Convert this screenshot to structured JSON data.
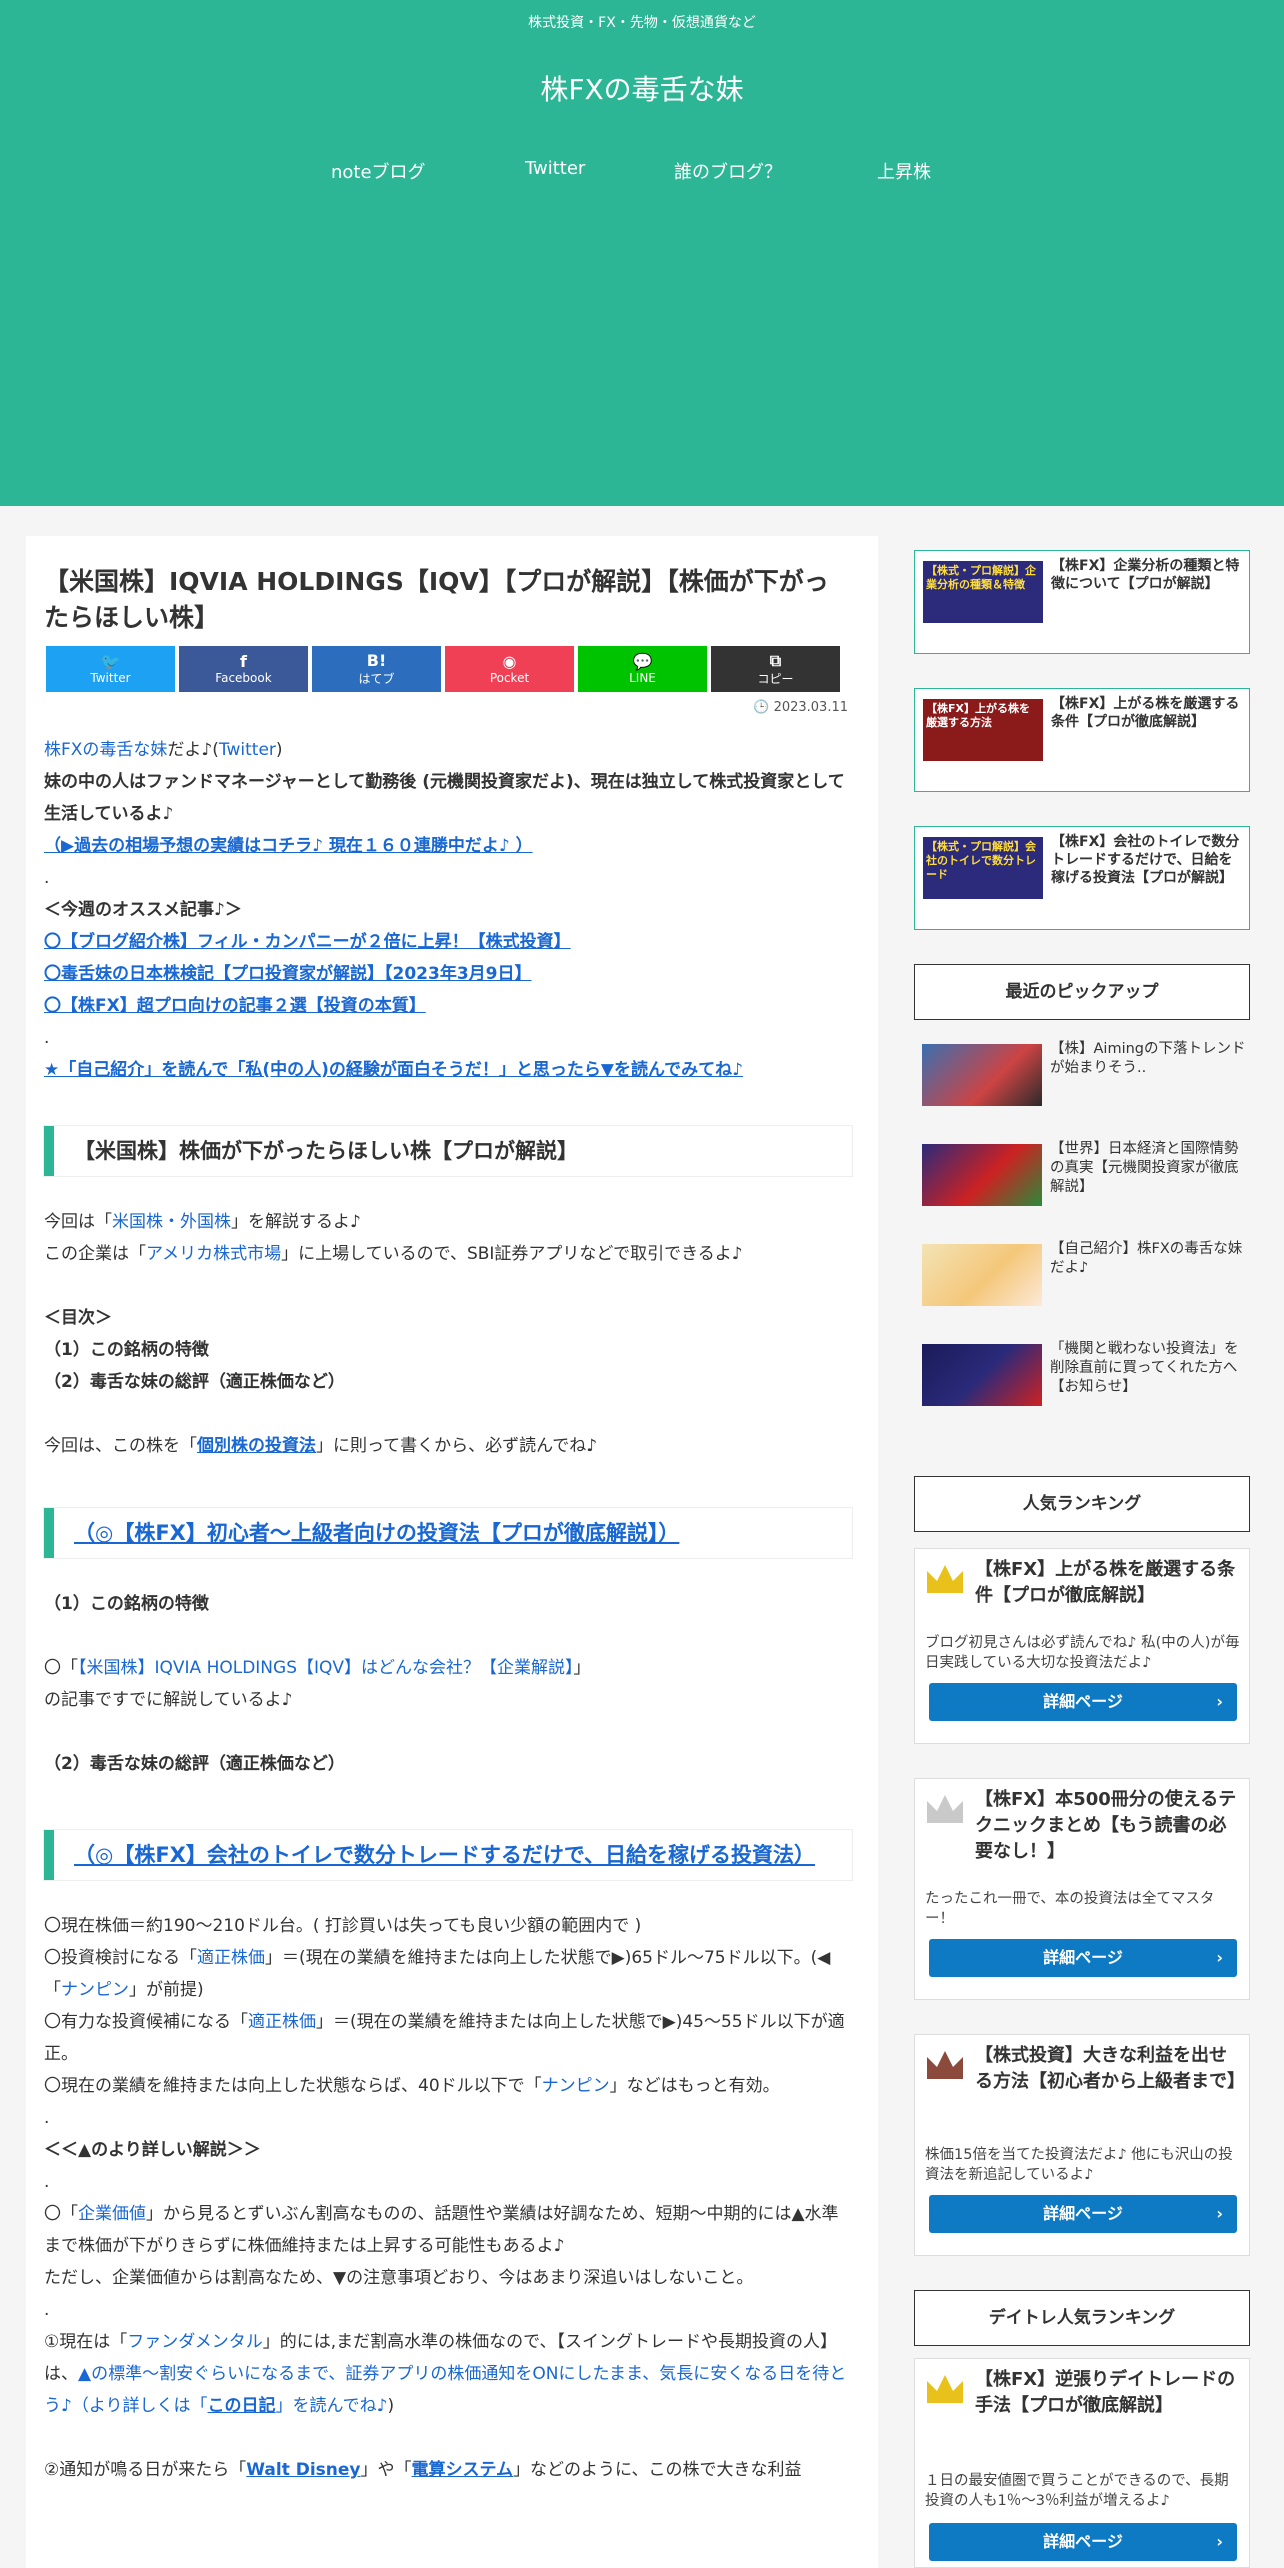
{
  "header": {
    "tagline": "株式投資・FX・先物・仮想通貨など",
    "title": "株FXの毒舌な妹",
    "nav": [
      "noteブログ",
      "Twitter",
      "誰のブログ？",
      "上昇株"
    ]
  },
  "post": {
    "title": "【米国株】IQVIA HOLDINGS【IQV】【プロが解説】【株価が下がったらほしい株】",
    "date": "2023.03.11",
    "share": [
      {
        "icon": "🐦",
        "label": "Twitter",
        "color": "#1da1f2"
      },
      {
        "icon": "f",
        "label": "Facebook",
        "color": "#3b5998"
      },
      {
        "icon": "B!",
        "label": "はてブ",
        "color": "#2c6ebd"
      },
      {
        "icon": "◉",
        "label": "Pocket",
        "color": "#ef4056"
      },
      {
        "icon": "💬",
        "label": "LINE",
        "color": "#00c300"
      },
      {
        "icon": "⧉",
        "label": "コピー",
        "color": "#333333"
      }
    ],
    "intro": {
      "link1": "株FXの毒舌な妹",
      "mid1": "だよ♪(",
      "link2": "Twitter",
      "end1": ")",
      "line2": "妹の中の人はファンドマネージャーとして勤務後 (元機関投資家だよ)、現在は独立して株式投資家として生活しているよ♪",
      "line3": "（▶過去の相場予想の実績はコチラ♪ 現在１６０連勝中だよ♪ ）",
      "dot": ".",
      "recommend_head": "＜今週のオススメ記事♪＞",
      "rec1": "〇【ブログ紹介株】フィル・カンパニーが２倍に上昇！【株式投資】",
      "rec2": "〇毒舌妹の日本株検記【プロ投資家が解説】【2023年3月9日】",
      "rec3": "〇【株FX】超プロ向けの記事２選【投資の本質】",
      "self_intro": "★「自己紹介」を読んで「私(中の人)の経験が面白そうだ！」と思ったら▼を読んでみてね♪"
    },
    "h2_1": "【米国株】株価が下がったらほしい株【プロが解説】",
    "p1_a": "今回は「",
    "p1_link": "米国株・外国株",
    "p1_b": "」を解説するよ♪",
    "p2_a": "この企業は「",
    "p2_link": "アメリカ株式市場",
    "p2_b": "」に上場しているので、SBI証券アプリなどで取引できるよ♪",
    "toc_head": "＜目次＞",
    "toc1": "（1）この銘柄の特徴",
    "toc2": "（2）毒舌な妹の総評（適正株価など）",
    "p3_a": "今回は、この株を「",
    "p3_link": "個別株の投資法",
    "p3_b": "」に則って書くから、必ず読んでね♪",
    "h2_2": "（◎【株FX】初心者～上級者向けの投資法【プロが徹底解説】）",
    "sec1_head": "（1）この銘柄の特徴",
    "sec1_a": "〇「",
    "sec1_link": "【米国株】IQVIA HOLDINGS【IQV】はどんな会社？【企業解説】",
    "sec1_b": "」",
    "sec1_c": "の記事ですでに解説しているよ♪",
    "sec2_head": "（2）毒舌な妹の総評（適正株価など）",
    "h2_3": "（◎【株FX】会社のトイレで数分トレードするだけで、日給を稼げる投資法）",
    "v1": "〇現在株価＝約190～210ドル台。( 打診買いは失っても良い少額の範囲内で )",
    "v2_a": "〇投資検討になる「",
    "v2_link": "適正株価",
    "v2_b": "」＝(現在の業績を維持または向上した状態で▶)65ドル～75ドル以下。(◀「",
    "v2_link2": "ナンピン",
    "v2_c": "」が前提)",
    "v3_a": "〇有力な投資候補になる「",
    "v3_link": "適正株価",
    "v3_b": "」＝(現在の業績を維持または向上した状態で▶)45～55ドル以下が適正。",
    "v4_a": "〇現在の業績を維持または向上した状態ならば、40ドル以下で「",
    "v4_link": "ナンピン",
    "v4_b": "」などはもっと有効。",
    "detail_head": "＜＜▲のより詳しい解説＞＞",
    "d1_a": "〇「",
    "d1_link": "企業価値",
    "d1_b": "」から見るとずいぶん割高なものの、話題性や業績は好調なため、短期～中期的には▲水準まで株価が下がりきらずに株価維持または上昇する可能性もあるよ♪",
    "d2": "ただし、企業価値からは割高なため、▼の注意事項どおり、今はあまり深追いはしないこと。",
    "d3_a": "①現在は「",
    "d3_link": "ファンダメンタル",
    "d3_b": "」的には,まだ割高水準の株価なので、【スイングトレードや長期投資の人】は、",
    "d3_link2": "▲の標準～割安ぐらいになるまで、証券アプリの株価通知をONにしたまま、気長に安くなる日を待とう♪（より詳しくは「",
    "d3_link3": "この日記",
    "d3_c": "」を読んでね♪",
    "d3_d": ")",
    "d4_a": "②通知が鳴る日が来たら「",
    "d4_link": "Walt Disney",
    "d4_b": "」や「",
    "d4_link2": "電算システム",
    "d4_c": "」などのように、この株で大きな利益"
  },
  "sidebar": {
    "top_cards": [
      {
        "thumb": "【株式・プロ解説】企業分析の種類＆特徴",
        "title": "【株FX】企業分析の種類と特徴について【プロが解説】"
      },
      {
        "thumb": "【株FX】上がる株を厳選する方法",
        "title": "【株FX】上がる株を厳選する条件【プロが徹底解説】"
      },
      {
        "thumb": "【株式・プロ解説】会社のトイレで数分トレード",
        "title": "【株FX】会社のトイレで数分トレードするだけで、日給を稼げる投資法【プロが解説】"
      }
    ],
    "pickup_head": "最近のピックアップ",
    "pickups": [
      {
        "title": "【株】Aimingの下落トレンドが始まりそう.."
      },
      {
        "title": "【世界】日本経済と国際情勢の真実【元機関投資家が徹底解説】"
      },
      {
        "title": "【自己紹介】株FXの毒舌な妹だよ♪"
      },
      {
        "title": "「機関と戦わない投資法」を削除直前に買ってくれた方へ【お知らせ】"
      }
    ],
    "ranking_head": "人気ランキング",
    "rankings": [
      {
        "title": "【株FX】上がる株を厳選する条件【プロが徹底解説】",
        "desc": "ブログ初見さんは必ず読んでね♪ 私(中の人)が毎日実践している大切な投資法だよ♪",
        "button": "詳細ページ",
        "crown_color": "#e8c21a"
      },
      {
        "title": "【株FX】本500冊分の使えるテクニックまとめ【もう読書の必要なし！】",
        "desc": "たったこれ一冊で、本の投資法は全てマスター！",
        "button": "詳細ページ",
        "crown_color": "#c9c9c9"
      },
      {
        "title": "【株式投資】大きな利益を出せる方法【初心者から上級者まで】",
        "desc": "株価15倍を当てた投資法だよ♪ 他にも沢山の投資法を新追記しているよ♪",
        "button": "詳細ページ",
        "crown_color": "#8b4a3c"
      }
    ],
    "day_ranking_head": "デイトレ人気ランキング",
    "day_rankings": [
      {
        "title": "【株FX】逆張りデイトレードの手法【プロが徹底解説】",
        "desc": "１日の最安値圏で買うことができるので、長期投資の人も1％～3％利益が増えるよ♪",
        "button": "詳細ページ",
        "crown_color": "#e8c21a"
      }
    ]
  }
}
